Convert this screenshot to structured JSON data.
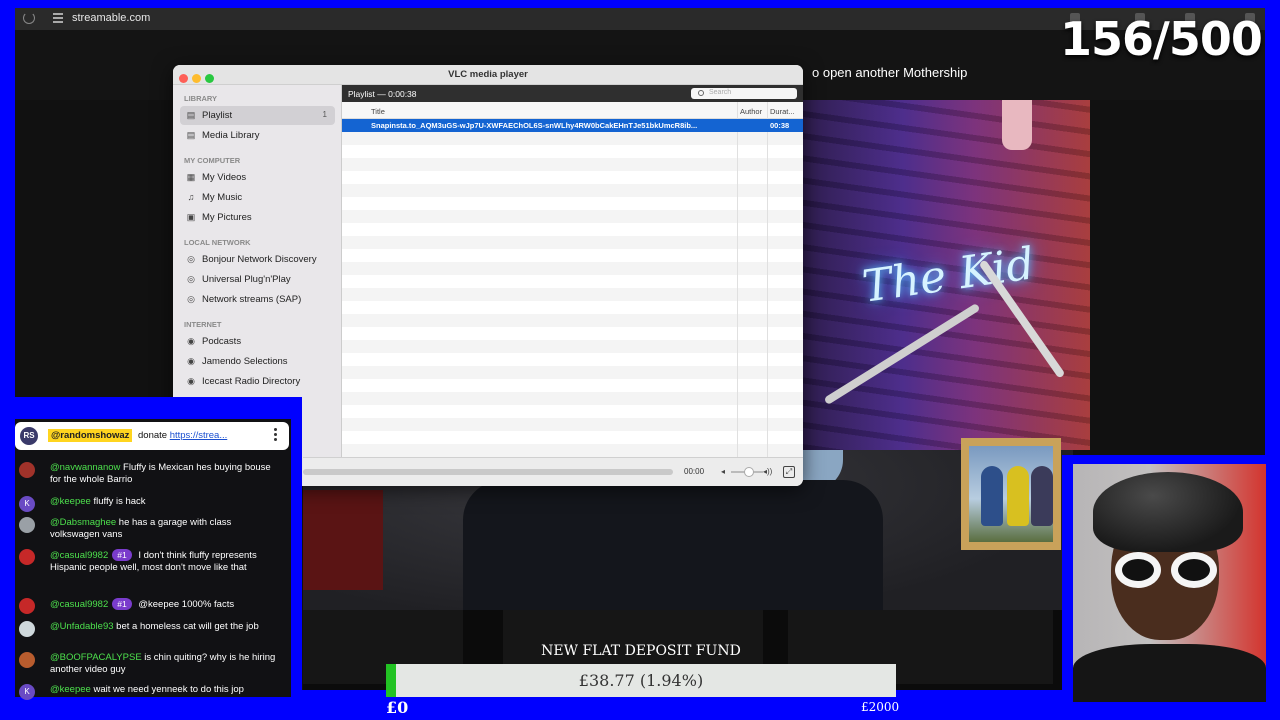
{
  "browser": {
    "url": "streamable.com"
  },
  "counter": {
    "text": "156/500"
  },
  "stream": {
    "headline_fragment": "o open another Mothership",
    "neon_sign": "The Kid"
  },
  "vlc": {
    "window_title": "VLC media player",
    "sidebar": {
      "library_header": "LIBRARY",
      "library_items": [
        {
          "label": "Playlist",
          "count": "1",
          "icon": "playlist-icon"
        },
        {
          "label": "Media Library",
          "icon": "media-library-icon"
        }
      ],
      "computer_header": "MY COMPUTER",
      "computer_items": [
        {
          "label": "My Videos",
          "icon": "video-icon"
        },
        {
          "label": "My Music",
          "icon": "music-icon"
        },
        {
          "label": "My Pictures",
          "icon": "pictures-icon"
        }
      ],
      "network_header": "LOCAL NETWORK",
      "network_items": [
        {
          "label": "Bonjour Network Discovery",
          "icon": "network-icon"
        },
        {
          "label": "Universal Plug'n'Play",
          "icon": "network-icon"
        },
        {
          "label": "Network streams (SAP)",
          "icon": "network-icon"
        }
      ],
      "internet_header": "INTERNET",
      "internet_items": [
        {
          "label": "Podcasts",
          "icon": "podcast-icon"
        },
        {
          "label": "Jamendo Selections",
          "icon": "podcast-icon"
        },
        {
          "label": "Icecast Radio Directory",
          "icon": "podcast-icon"
        }
      ]
    },
    "playlist": {
      "header": "Playlist — 0:00:38",
      "search_placeholder": "Search",
      "columns": {
        "title": "Title",
        "author": "Author",
        "duration": "Durat..."
      },
      "selected_row": {
        "title": "Snapinsta.to_AQM3uGS-wJp7U-XWFAEChOL6S-snWLhy4RW0bCakEHnTJe51bkUmcR8ib...",
        "author": "",
        "duration": "00:38"
      }
    },
    "controls": {
      "time": "00:00",
      "progress": 0
    }
  },
  "chat": {
    "pinned": {
      "avatar_text": "RS",
      "user": "@randomshowaz",
      "message": "donate ",
      "link": "https://strea..."
    },
    "messages": [
      {
        "user": "@navwannanow",
        "text": " Fluffy is Mexican hes buying bouse for the whole Barrio",
        "avatar_color": "#a0322a"
      },
      {
        "user": "@keepee",
        "text": " fluffy is hack",
        "avatar_color": "#6a4bc4",
        "avatar_letter": "K"
      },
      {
        "user": "@Dabsmaghee",
        "text": " he has a garage with class volkswagen vans",
        "avatar_color": "#9aa0a6"
      },
      {
        "user": "@casual9982",
        "badge": "#1",
        "text": " I don't think fluffy represents Hispanic people well, most don't move like that",
        "avatar_color": "#c62828"
      },
      {
        "user": "@casual9982",
        "badge": "#1",
        "text": " @keepee 1000% facts",
        "avatar_color": "#c62828"
      },
      {
        "user": "@Unfadable93",
        "text": " bet a homeless cat will get the job",
        "avatar_color": "#cfd8dc"
      },
      {
        "user": "@BOOFPACALYPSE",
        "text": " is chin quiting? why is he hiring another video guy",
        "avatar_color": "#b85c2e"
      },
      {
        "user": "@keepee",
        "text": " wait we need yenneek to do this jop",
        "avatar_color": "#6a4bc4",
        "avatar_letter": "K"
      }
    ]
  },
  "fund": {
    "title": "NEW FLAT DEPOSIT FUND",
    "amount": "£38.77 (1.94%)",
    "progress_percent": 1.94,
    "min_label": "£0",
    "max_label": "£2000"
  }
}
